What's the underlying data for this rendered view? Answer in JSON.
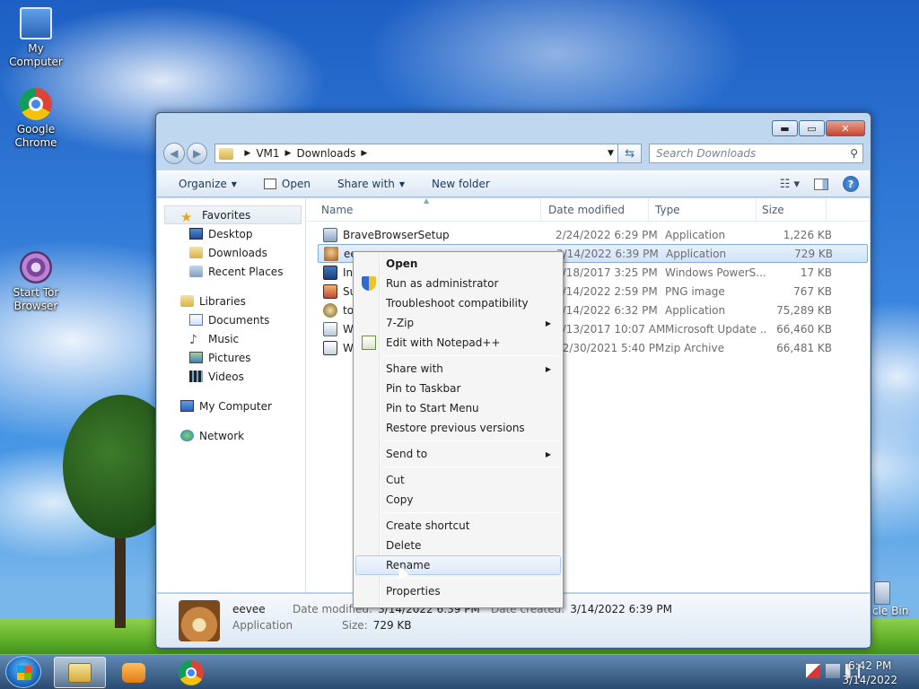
{
  "desktop": {
    "icons": [
      {
        "label": "My Computer",
        "icon": "computer-icon"
      },
      {
        "label": "Google Chrome",
        "icon": "chrome-icon"
      },
      {
        "label": "Start Tor Browser",
        "icon": "tor-browser-icon"
      }
    ],
    "recycle_bin_label": "cle Bin"
  },
  "window": {
    "controls": {
      "minimize": "▬",
      "maximize": "▭",
      "close": "✕"
    },
    "address": {
      "segments": [
        "VM1",
        "Downloads"
      ]
    },
    "search": {
      "placeholder": "Search Downloads"
    },
    "toolbar": {
      "organize": "Organize",
      "open": "Open",
      "share_with": "Share with",
      "new_folder": "New folder"
    },
    "nav": {
      "favorites": "Favorites",
      "desktop": "Desktop",
      "downloads": "Downloads",
      "recent_places": "Recent Places",
      "libraries": "Libraries",
      "documents": "Documents",
      "music": "Music",
      "pictures": "Pictures",
      "videos": "Videos",
      "my_computer": "My Computer",
      "network": "Network"
    },
    "columns": {
      "name": "Name",
      "date": "Date modified",
      "type": "Type",
      "size": "Size"
    },
    "files": [
      {
        "name": "BraveBrowserSetup",
        "date": "2/24/2022 6:29 PM",
        "type": "Application",
        "size": "1,226 KB",
        "icon": "brave-setup-icon"
      },
      {
        "name": "eevee",
        "date": "3/14/2022 6:39 PM",
        "type": "Application",
        "size": "729 KB",
        "icon": "eevee-icon"
      },
      {
        "name": "Ins",
        "date": "8/18/2017 3:25 PM",
        "type": "Windows PowerS...",
        "size": "17 KB",
        "icon": "powershell-icon"
      },
      {
        "name": "Sur",
        "date": "3/14/2022 2:59 PM",
        "type": "PNG image",
        "size": "767 KB",
        "icon": "png-icon"
      },
      {
        "name": "tor",
        "date": "3/14/2022 6:32 PM",
        "type": "Application",
        "size": "75,289 KB",
        "icon": "tor-icon"
      },
      {
        "name": "Wi",
        "date": "3/13/2017 10:07 AM",
        "type": "Microsoft Update ...",
        "size": "66,460 KB",
        "icon": "msu-icon"
      },
      {
        "name": "Wi",
        "date": "12/30/2021 5:40 PM",
        "type": "zip Archive",
        "size": "66,481 KB",
        "icon": "zip-icon"
      }
    ],
    "details": {
      "name": "eevee",
      "type": "Application",
      "modified_label": "Date modified:",
      "modified_value": "3/14/2022 6:39 PM",
      "size_label": "Size:",
      "size_value": "729 KB",
      "created_label": "Date created:",
      "created_value": "3/14/2022 6:39 PM"
    }
  },
  "context_menu": {
    "open": "Open",
    "run_as_admin": "Run as administrator",
    "troubleshoot": "Troubleshoot compatibility",
    "zip": "7-Zip",
    "notepad": "Edit with Notepad++",
    "share_with": "Share with",
    "pin_taskbar": "Pin to Taskbar",
    "pin_start": "Pin to Start Menu",
    "restore": "Restore previous versions",
    "send_to": "Send to",
    "cut": "Cut",
    "copy": "Copy",
    "create_shortcut": "Create shortcut",
    "delete": "Delete",
    "rename": "Rename",
    "properties": "Properties"
  },
  "taskbar": {
    "time": "6:42 PM",
    "date": "3/14/2022"
  }
}
